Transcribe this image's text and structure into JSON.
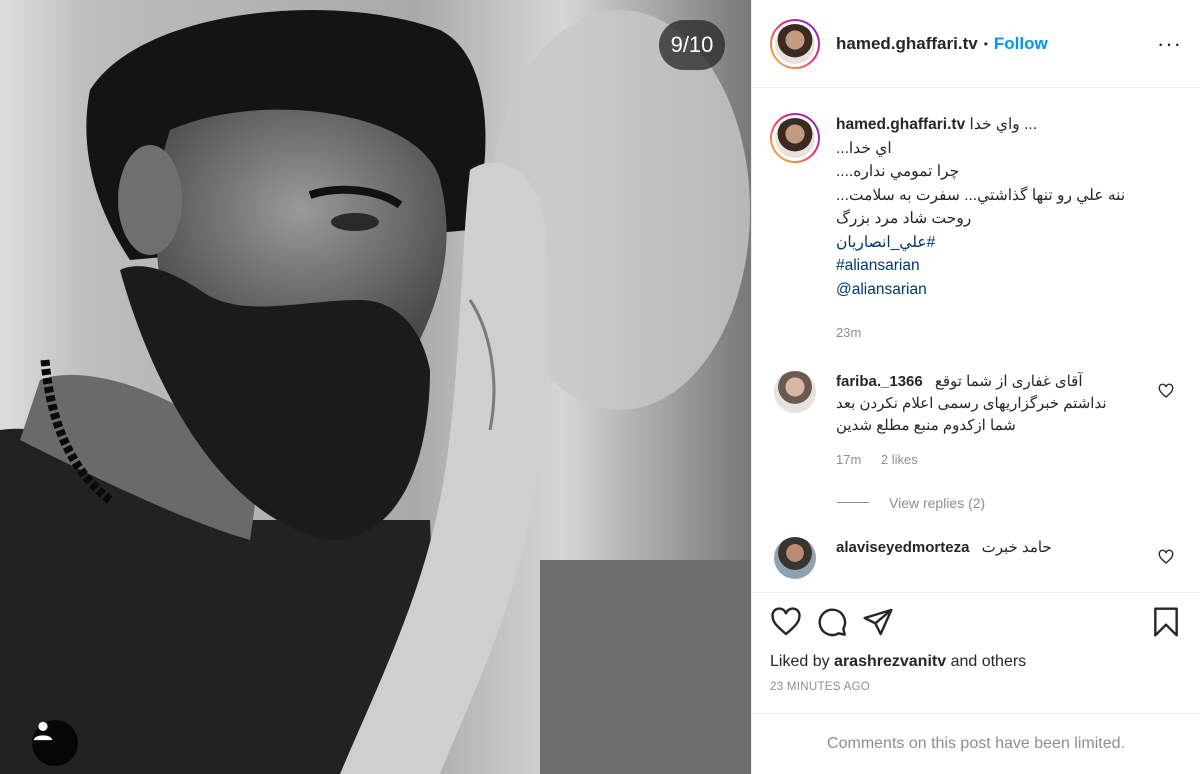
{
  "photo": {
    "counter": "9/10",
    "tag_icon": "user-icon"
  },
  "header": {
    "username": "hamed.ghaffari.tv",
    "separator": "•",
    "follow_label": "Follow",
    "more_icon": "more-horizontal-icon",
    "more_label": "···"
  },
  "caption": {
    "username": "hamed.ghaffari.tv",
    "lines": [
      "واي خدا ...",
      "اي خدا...",
      "چرا تمومي نداره....",
      "ننه علي رو تنها گذاشتي... سفرت به سلامت...",
      "روحت شاد مرد بزرگ"
    ],
    "hashtags": [
      "#علي_انصاريان",
      "#aliansarian"
    ],
    "mention": "@aliansarian",
    "time": "23m"
  },
  "comments": [
    {
      "username": "fariba._1366",
      "text": "آقای غفاری از شما توقع نداشتم خبرگزاریهای رسمی اعلام نکردن بعد شما ازکدوم منبع مطلع شدین",
      "time": "17m",
      "likes": "2 likes",
      "view_replies": "View replies (2)"
    },
    {
      "username": "alaviseyedmorteza",
      "text": "حامد خبرت"
    }
  ],
  "actions": {
    "liked_prefix": "Liked by",
    "liked_user": "arashrezvanitv",
    "liked_suffix": "and others",
    "timestamp": "23 MINUTES AGO",
    "limited_text": "Comments on this post have been limited."
  }
}
